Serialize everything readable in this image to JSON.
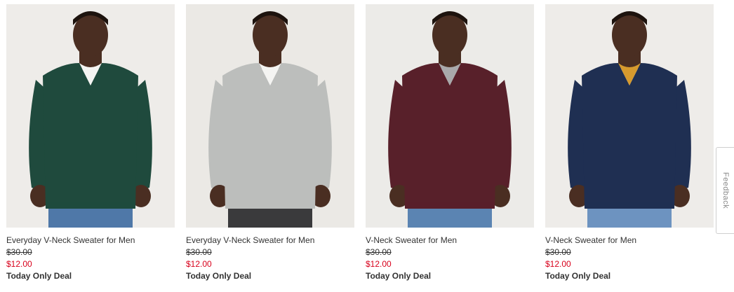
{
  "products": [
    {
      "name": "Everyday V-Neck Sweater for Men",
      "original_price": "$30.00",
      "sale_price": "$12.00",
      "badge": "Today Only Deal",
      "sweater_color": "#1f4a3d",
      "undershirt_color": "#f4f4f2",
      "background_color": "#eeece9",
      "jeans_color": "#4f78a8"
    },
    {
      "name": "Everyday V-Neck Sweater for Men",
      "original_price": "$30.00",
      "sale_price": "$12.00",
      "badge": "Today Only Deal",
      "sweater_color": "#bcbebc",
      "undershirt_color": "#f4f4f2",
      "background_color": "#ebe9e5",
      "jeans_color": "#3a3a3c"
    },
    {
      "name": "V-Neck Sweater for Men",
      "original_price": "$30.00",
      "sale_price": "$12.00",
      "badge": "Today Only Deal",
      "sweater_color": "#58202a",
      "undershirt_color": "#a9a9ab",
      "background_color": "#ecebe8",
      "jeans_color": "#5b84b2"
    },
    {
      "name": "V-Neck Sweater for Men",
      "original_price": "$30.00",
      "sale_price": "$12.00",
      "badge": "Today Only Deal",
      "sweater_color": "#1f2f52",
      "undershirt_color": "#d69a2e",
      "background_color": "#eeece9",
      "jeans_color": "#6d93c0"
    }
  ],
  "feedback_tab": {
    "label": "Feedback"
  }
}
